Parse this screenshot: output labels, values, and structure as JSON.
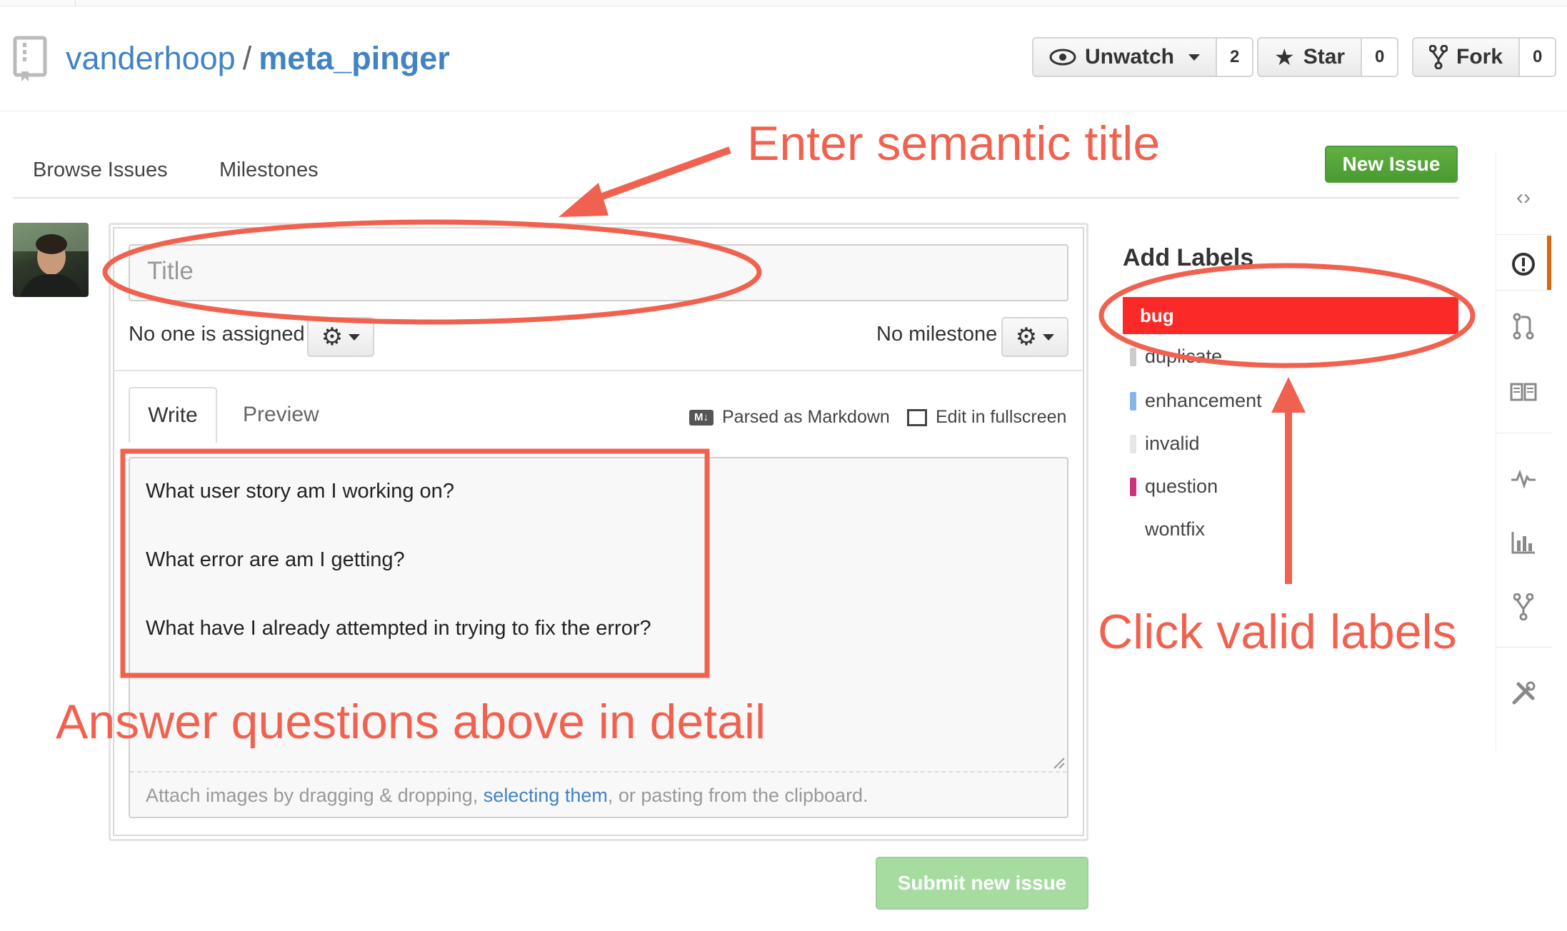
{
  "repo": {
    "owner": "vanderhoop",
    "separator": "/",
    "name": "meta_pinger"
  },
  "header_buttons": {
    "unwatch_label": "Unwatch",
    "unwatch_count": "2",
    "star_label": "Star",
    "star_count": "0",
    "fork_label": "Fork",
    "fork_count": "0"
  },
  "subnav": {
    "browse_issues": "Browse Issues",
    "milestones": "Milestones",
    "new_issue": "New Issue"
  },
  "form": {
    "title_placeholder": "Title",
    "assignee_text": "No one is assigned",
    "milestone_text": "No milestone",
    "tab_write": "Write",
    "tab_preview": "Preview",
    "parsed_markdown": "Parsed as Markdown",
    "markdown_badge": "M↓",
    "edit_fullscreen": "Edit in fullscreen",
    "body_lines": [
      "What user story am I working on?",
      "What error are am I getting?",
      "What have I already attempted in trying to fix the error?"
    ],
    "attach_prefix": "Attach images by dragging & dropping, ",
    "attach_link": "selecting them",
    "attach_suffix": ", or pasting from the clipboard.",
    "submit": "Submit new issue"
  },
  "labels": {
    "title": "Add Labels",
    "items": [
      {
        "name": "bug",
        "color": "#fc2929"
      },
      {
        "name": "duplicate",
        "color": "#cccccc"
      },
      {
        "name": "enhancement",
        "color": "#84b6eb"
      },
      {
        "name": "invalid",
        "color": "#e6e6e6"
      },
      {
        "name": "question",
        "color": "#cc317c"
      },
      {
        "name": "wontfix",
        "color": "#ffffff"
      }
    ]
  },
  "annotations": {
    "title_note": "Enter semantic title",
    "labels_note": "Click valid labels",
    "body_note": "Answer questions above in detail",
    "color": "#f0624f"
  },
  "colors": {
    "link": "#4183c4",
    "new_issue_green": "#60b044",
    "submit_disabled_green": "#a6dca0",
    "active_nav": "#d26911"
  }
}
